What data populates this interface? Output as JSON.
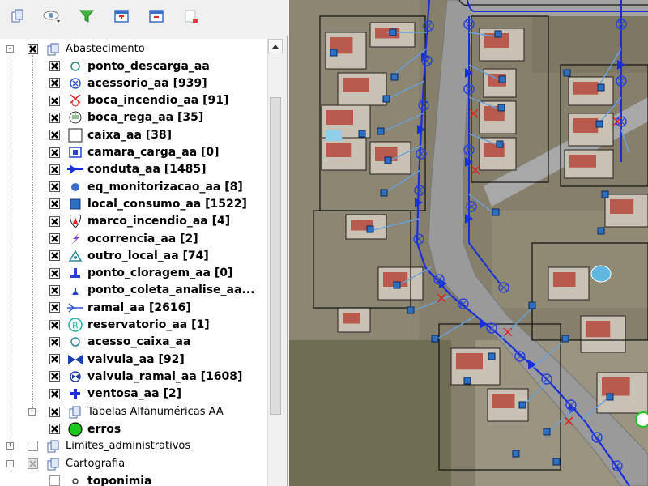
{
  "toolbar": {
    "buttons": [
      {
        "name": "add-group-button",
        "icon": "layers-icon"
      },
      {
        "name": "manage-visibility-button",
        "icon": "eye-icon"
      },
      {
        "name": "filter-legend-button",
        "icon": "filter-icon"
      },
      {
        "name": "expand-all-button",
        "icon": "expand-all-icon"
      },
      {
        "name": "collapse-all-button",
        "icon": "collapse-all-icon"
      },
      {
        "name": "remove-layer-button",
        "icon": "remove-layer-icon"
      }
    ]
  },
  "tree": {
    "group_abastecimento": {
      "label": "Abastecimento"
    },
    "layers": [
      {
        "label": "ponto_descarga_aa",
        "icon": "circle-outline-icon"
      },
      {
        "label": "acessorio_aa [939]",
        "icon": "cross-circle-icon"
      },
      {
        "label": "boca_incendio_aa [91]",
        "icon": "hydrant-icon"
      },
      {
        "label": "boca_rega_aa [35]",
        "icon": "irrigation-icon"
      },
      {
        "label": "caixa_aa [38]",
        "icon": "square-outline-icon"
      },
      {
        "label": "camara_carga_aa [0]",
        "icon": "chamber-icon"
      },
      {
        "label": "conduta_aa [1485]",
        "icon": "pipe-arrow-icon"
      },
      {
        "label": "eq_monitorizacao_aa [8]",
        "icon": "monitor-dot-icon"
      },
      {
        "label": "local_consumo_aa [1522]",
        "icon": "consumer-square-icon"
      },
      {
        "label": "marco_incendio_aa [4]",
        "icon": "fire-post-icon"
      },
      {
        "label": "ocorrencia_aa [2]",
        "icon": "lightning-icon"
      },
      {
        "label": "outro_local_aa [74]",
        "icon": "triangle-icon"
      },
      {
        "label": "ponto_cloragem_aa [0]",
        "icon": "chlorination-icon"
      },
      {
        "label": "ponto_coleta_analise_aa...",
        "icon": "flask-icon"
      },
      {
        "label": "ramal_aa [2616]",
        "icon": "branch-icon"
      },
      {
        "label": "reservatorio_aa [1]",
        "icon": "reservoir-r-icon"
      },
      {
        "label": "acesso_caixa_aa",
        "icon": "circle-small-icon"
      },
      {
        "label": "valvula_aa [92]",
        "icon": "valve-icon"
      },
      {
        "label": "valvula_ramal_aa [1608]",
        "icon": "valve-branch-icon"
      },
      {
        "label": "ventosa_aa [2]",
        "icon": "air-valve-icon"
      }
    ],
    "tabelas": {
      "label": "Tabelas Alfanuméricas AA"
    },
    "erros": {
      "label": "erros",
      "icon": "green-circle-icon"
    },
    "limites": {
      "label": "Limites_administrativos"
    },
    "cartografia": {
      "label": "Cartografia"
    },
    "toponimia": {
      "label": "toponimia"
    }
  },
  "colors": {
    "network_blue": "#1a2fd6",
    "point_blue": "#2f6fbf",
    "error_green": "#1ec71e",
    "road_grey": "#9a9a9a"
  }
}
